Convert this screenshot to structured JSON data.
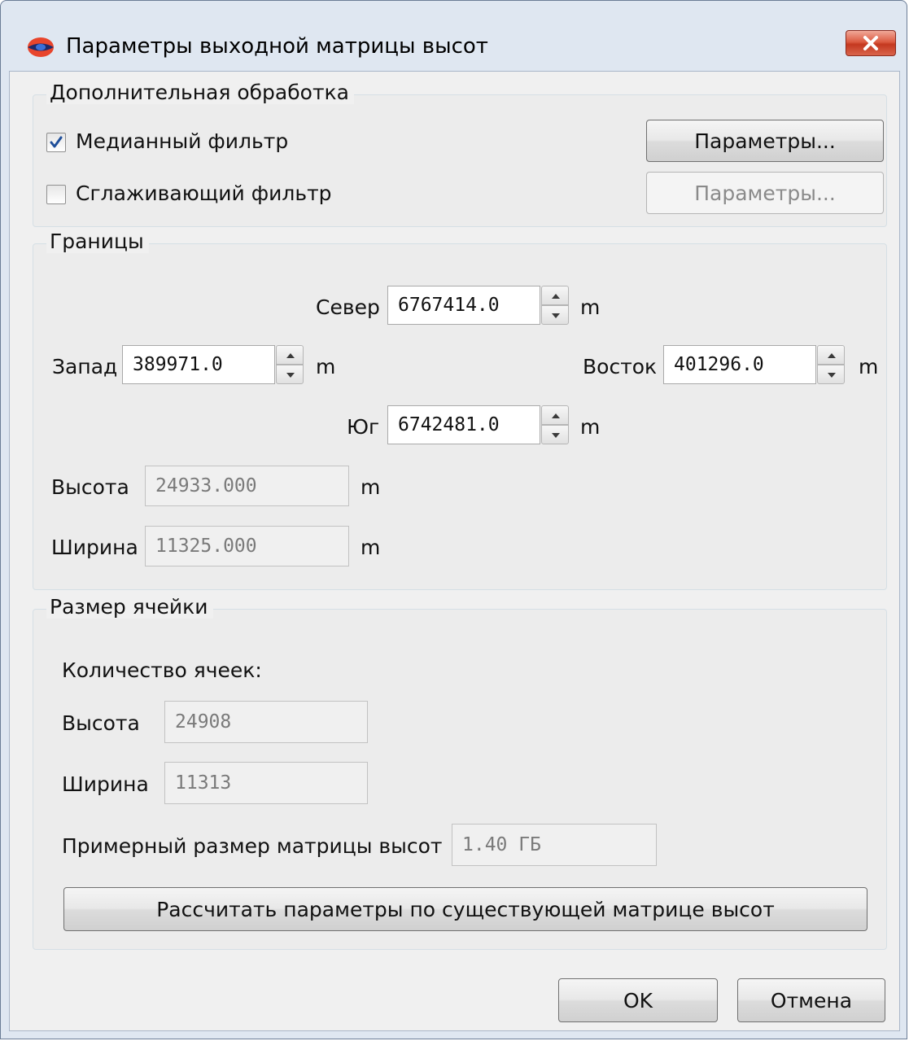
{
  "window": {
    "title": "Параметры выходной матрицы высот"
  },
  "processing": {
    "title": "Дополнительная обработка",
    "median": {
      "label": "Медианный фильтр",
      "checked": true,
      "button": "Параметры..."
    },
    "smoothing": {
      "label": "Сглаживающий фильтр",
      "checked": false,
      "button": "Параметры..."
    }
  },
  "bounds": {
    "title": "Границы",
    "north": {
      "label": "Север",
      "value": "6767414.0",
      "unit": "m"
    },
    "west": {
      "label": "Запад",
      "value": "389971.0",
      "unit": "m"
    },
    "east": {
      "label": "Восток",
      "value": "401296.0",
      "unit": "m"
    },
    "south": {
      "label": "Юг",
      "value": "6742481.0",
      "unit": "m"
    },
    "height": {
      "label": "Высота",
      "value": "24933.000",
      "unit": "m"
    },
    "width": {
      "label": "Ширина",
      "value": "11325.000",
      "unit": "m"
    }
  },
  "cell": {
    "title": "Размер ячейки",
    "count_label": "Количество ячеек:",
    "height": {
      "label": "Высота",
      "value": "24908"
    },
    "width": {
      "label": "Ширина",
      "value": "11313"
    },
    "size": {
      "label": "Примерный размер матрицы высот",
      "value": "1.40 ГБ"
    },
    "calc_button": "Рассчитать параметры по существующей матрице высот"
  },
  "footer": {
    "ok": "OK",
    "cancel": "Отмена"
  },
  "colors": {
    "frame": "#dfe7f1",
    "client": "#f0f0f0",
    "close": "#c4381f",
    "check": "#1f4f9a"
  },
  "icons": {
    "app": "app-logo-icon",
    "close": "close-icon",
    "check": "checkmark-icon",
    "spin_up": "arrow-up-icon",
    "spin_down": "arrow-down-icon"
  }
}
